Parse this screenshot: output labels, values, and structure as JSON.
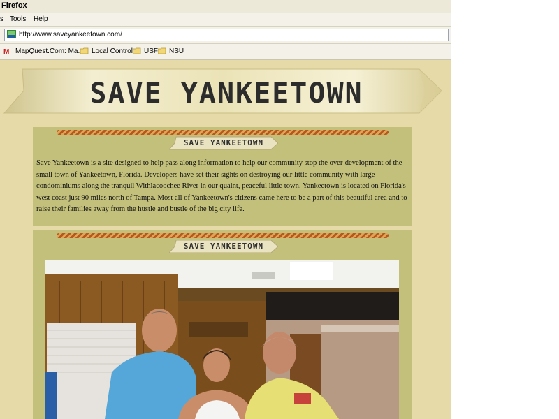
{
  "browser": {
    "window_title": "Firefox",
    "menu": [
      "s",
      "Tools",
      "Help"
    ],
    "url": "http://www.saveyankeetown.com/",
    "bookmarks": [
      {
        "label": "MapQuest.Com: Ma...",
        "icon": "mapquest-icon"
      },
      {
        "label": "Local Controls",
        "icon": "folder-icon"
      },
      {
        "label": "USF",
        "icon": "folder-icon"
      },
      {
        "label": "NSU",
        "icon": "folder-icon"
      }
    ]
  },
  "page": {
    "banner_title": "SAVE YANKEETOWN",
    "section1": {
      "tag": "SAVE YANKEETOWN",
      "text": "Save Yankeetown is a site designed to help pass along information to help our community stop the over-development of the small town of Yankeetown, Florida. Developers have set their sights on destroying our little community with large condominiums along the tranquil Withlacoochee River in our quaint, peaceful little town. Yankeetown is located on Florida's west coast just 90 miles north of Tampa. Most all of Yankeetown's citizens came here to be a part of this beautiful area and to raise their families away from the hustle and bustle of the big city life."
    },
    "section2": {
      "tag": "SAVE YANKEETOWN",
      "photo_icon": "group-photo-icon"
    }
  },
  "colors": {
    "page_background": "#e6dba8",
    "panel_background": "#c3c07b",
    "rope": "#c0702a",
    "banner_ribbon": "#e9e2b9"
  }
}
